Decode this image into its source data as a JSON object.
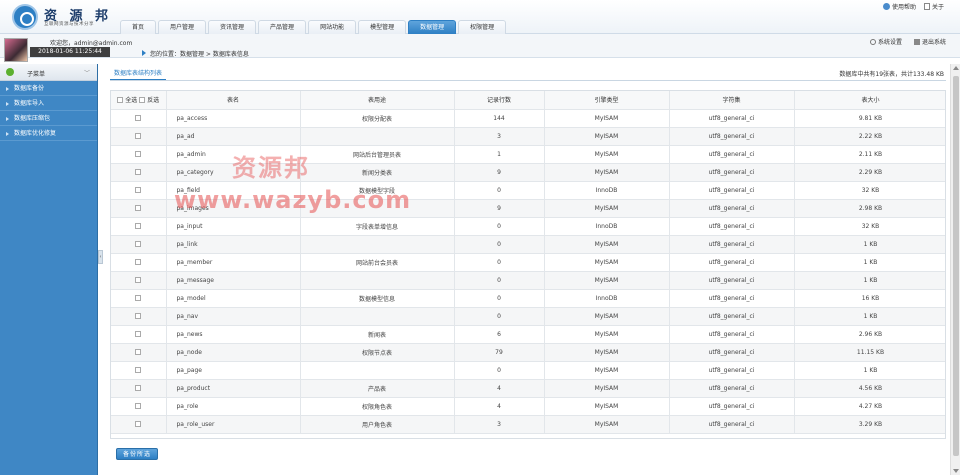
{
  "header": {
    "brand": "资 源 邦",
    "slogan": "互联网资源与技术分享",
    "nav": [
      "首页",
      "用户管理",
      "资讯管理",
      "产品管理",
      "网站功能",
      "模型管理",
      "数据管理",
      "权限管理"
    ],
    "active_nav": "数据管理",
    "help": "使用帮助",
    "about": "关于"
  },
  "userbar": {
    "welcome": "欢迎您，admin@admin.com",
    "datetime": "2018-01-06 11:25:44",
    "breadcrumb": "您的位置：数据管理 > 数据库表信息",
    "settings": "系统设置",
    "logout": "退出系统"
  },
  "sidebar": {
    "title": "子菜单",
    "items": [
      "数据库备份",
      "数据库导入",
      "数据库压缩包",
      "数据库优化修复"
    ]
  },
  "main": {
    "tab": "数据库表结构列表",
    "summary": "数据库中共有19张表，共计133.48 KB",
    "select_all": "全选",
    "invert": "反选",
    "backup_button": "备份所选"
  },
  "table": {
    "headers": [
      "表名",
      "表用途",
      "记录行数",
      "引擎类型",
      "字符集",
      "表大小"
    ],
    "rows": [
      [
        "pa_access",
        "权限分配表",
        "144",
        "MyISAM",
        "utf8_general_ci",
        "9.81 KB"
      ],
      [
        "pa_ad",
        "",
        "3",
        "MyISAM",
        "utf8_general_ci",
        "2.22 KB"
      ],
      [
        "pa_admin",
        "网站后台管理员表",
        "1",
        "MyISAM",
        "utf8_general_ci",
        "2.11 KB"
      ],
      [
        "pa_category",
        "新闻分类表",
        "9",
        "MyISAM",
        "utf8_general_ci",
        "2.29 KB"
      ],
      [
        "pa_field",
        "数据模型字段",
        "0",
        "InnoDB",
        "utf8_general_ci",
        "32 KB"
      ],
      [
        "pa_images",
        "",
        "9",
        "MyISAM",
        "utf8_general_ci",
        "2.98 KB"
      ],
      [
        "pa_input",
        "字段表单增信息",
        "0",
        "InnoDB",
        "utf8_general_ci",
        "32 KB"
      ],
      [
        "pa_link",
        "",
        "0",
        "MyISAM",
        "utf8_general_ci",
        "1 KB"
      ],
      [
        "pa_member",
        "网站前台会员表",
        "0",
        "MyISAM",
        "utf8_general_ci",
        "1 KB"
      ],
      [
        "pa_message",
        "",
        "0",
        "MyISAM",
        "utf8_general_ci",
        "1 KB"
      ],
      [
        "pa_model",
        "数据模型信息",
        "0",
        "InnoDB",
        "utf8_general_ci",
        "16 KB"
      ],
      [
        "pa_nav",
        "",
        "0",
        "MyISAM",
        "utf8_general_ci",
        "1 KB"
      ],
      [
        "pa_news",
        "新闻表",
        "6",
        "MyISAM",
        "utf8_general_ci",
        "2.96 KB"
      ],
      [
        "pa_node",
        "权限节点表",
        "79",
        "MyISAM",
        "utf8_general_ci",
        "11.15 KB"
      ],
      [
        "pa_page",
        "",
        "0",
        "MyISAM",
        "utf8_general_ci",
        "1 KB"
      ],
      [
        "pa_product",
        "产品表",
        "4",
        "MyISAM",
        "utf8_general_ci",
        "4.56 KB"
      ],
      [
        "pa_role",
        "权限角色表",
        "4",
        "MyISAM",
        "utf8_general_ci",
        "4.27 KB"
      ],
      [
        "pa_role_user",
        "用户角色表",
        "3",
        "MyISAM",
        "utf8_general_ci",
        "3.29 KB"
      ]
    ]
  },
  "watermark": {
    "line1": "资源邦",
    "line2": "www.wazyb.com"
  }
}
